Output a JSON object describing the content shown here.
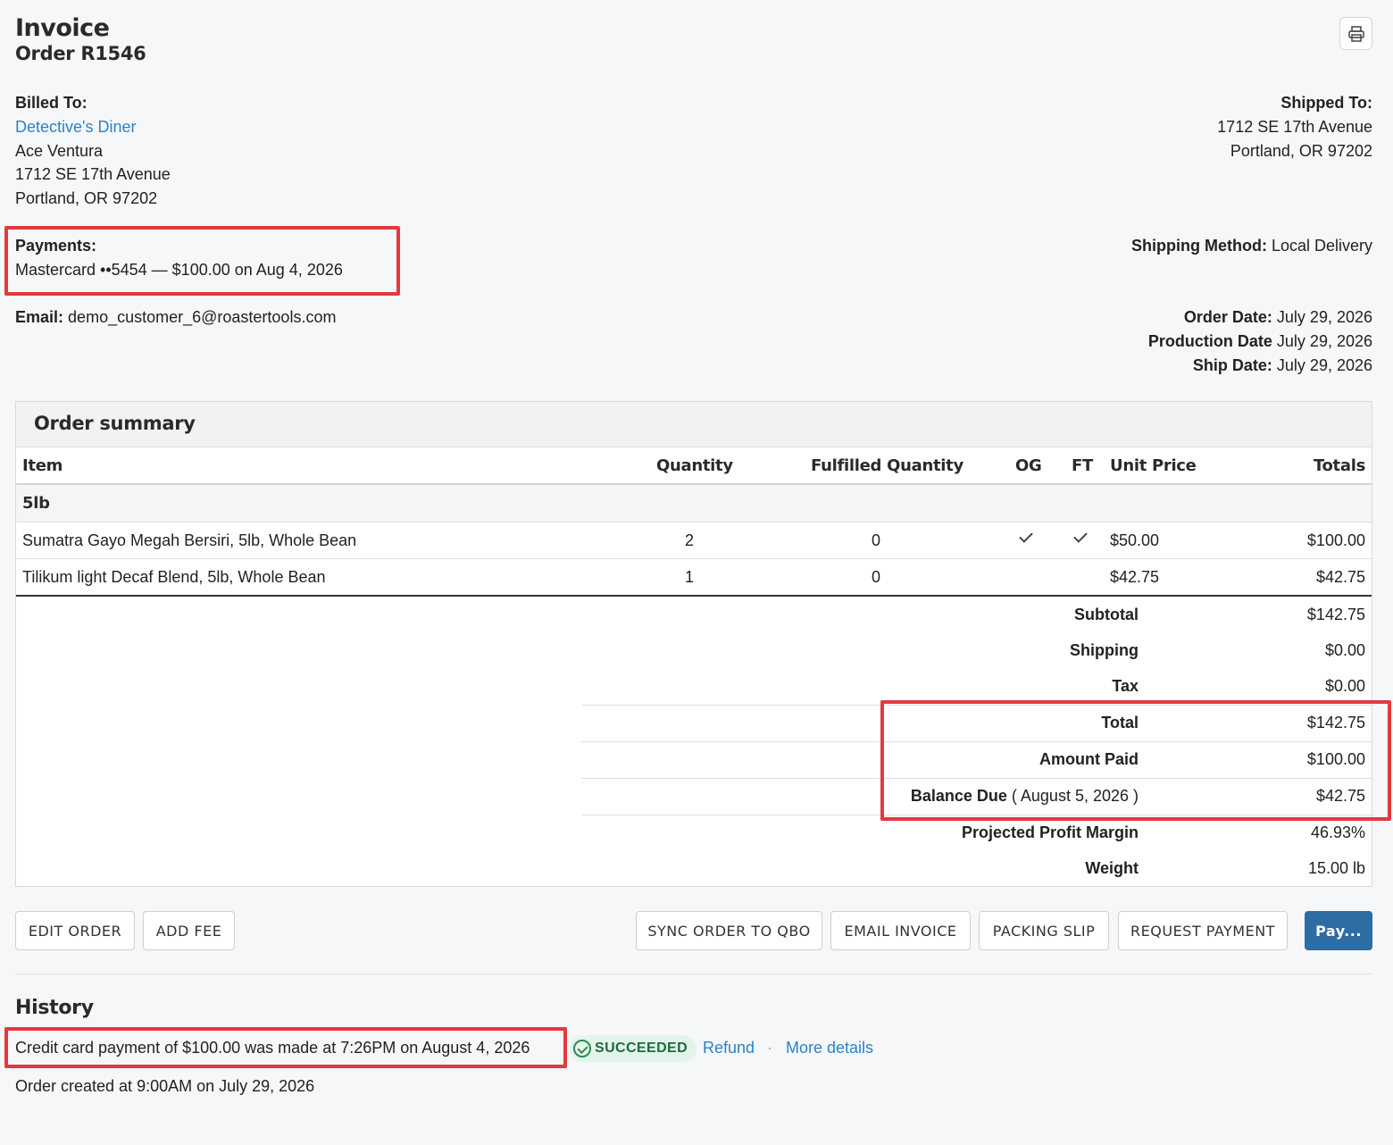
{
  "header": {
    "title": "Invoice",
    "order": "Order R1546"
  },
  "billed": {
    "label": "Billed To:",
    "company": "Detective's Diner",
    "name": "Ace Ventura",
    "street": "1712 SE 17th Avenue",
    "city": "Portland, OR 97202"
  },
  "shipped": {
    "label": "Shipped To:",
    "street": "1712 SE 17th Avenue",
    "city": "Portland, OR 97202"
  },
  "payments": {
    "label": "Payments:",
    "entry": "Mastercard ••5454 — $100.00 on Aug 4, 2026"
  },
  "shipping_method": {
    "label": "Shipping Method:",
    "value": "Local Delivery"
  },
  "email": {
    "label": "Email:",
    "value": "demo_customer_6@roastertools.com"
  },
  "dates": {
    "order_label": "Order Date:",
    "order_value": "July 29, 2026",
    "production_label": "Production Date",
    "production_value": "July 29, 2026",
    "ship_label": "Ship Date:",
    "ship_value": "July 29, 2026"
  },
  "summary": {
    "title": "Order summary",
    "columns": {
      "item": "Item",
      "quantity": "Quantity",
      "fulfilled": "Fulfilled Quantity",
      "og": "OG",
      "ft": "FT",
      "unit_price": "Unit Price",
      "totals": "Totals"
    },
    "group": "5lb",
    "rows": [
      {
        "item": "Sumatra Gayo Megah Bersiri, 5lb, Whole Bean",
        "quantity": "2",
        "fulfilled": "0",
        "og": true,
        "ft": true,
        "unit_price": "$50.00",
        "total": "$100.00"
      },
      {
        "item": "Tilikum light Decaf Blend, 5lb, Whole Bean",
        "quantity": "1",
        "fulfilled": "0",
        "og": false,
        "ft": false,
        "unit_price": "$42.75",
        "total": "$42.75"
      }
    ],
    "totals": {
      "subtotal_label": "Subtotal",
      "subtotal": "$142.75",
      "shipping_label": "Shipping",
      "shipping": "$0.00",
      "tax_label": "Tax",
      "tax": "$0.00",
      "total_label": "Total",
      "total": "$142.75",
      "paid_label": "Amount Paid",
      "paid": "$100.00",
      "balance_label": "Balance Due",
      "balance_date": "( August 5, 2026 )",
      "balance": "$42.75",
      "margin_label": "Projected Profit Margin",
      "margin": "46.93%",
      "weight_label": "Weight",
      "weight": "15.00 lb"
    }
  },
  "buttons": {
    "edit": "EDIT ORDER",
    "fee": "ADD FEE",
    "sync": "SYNC ORDER TO QBO",
    "email": "EMAIL INVOICE",
    "slip": "PACKING SLIP",
    "request": "REQUEST PAYMENT",
    "pay": "Pay..."
  },
  "history": {
    "title": "History",
    "payment_event": "Credit card payment of $100.00 was made at 7:26PM on August 4, 2026",
    "status": "SUCCEEDED",
    "refund": "Refund",
    "separator": "·",
    "more": "More details",
    "created": "Order created at 9:00AM on July 29, 2026"
  },
  "colors": {
    "accent": "#2e6da4",
    "link": "#2c82c9",
    "highlight": "#e3393f",
    "success": "#1d6b3b"
  }
}
